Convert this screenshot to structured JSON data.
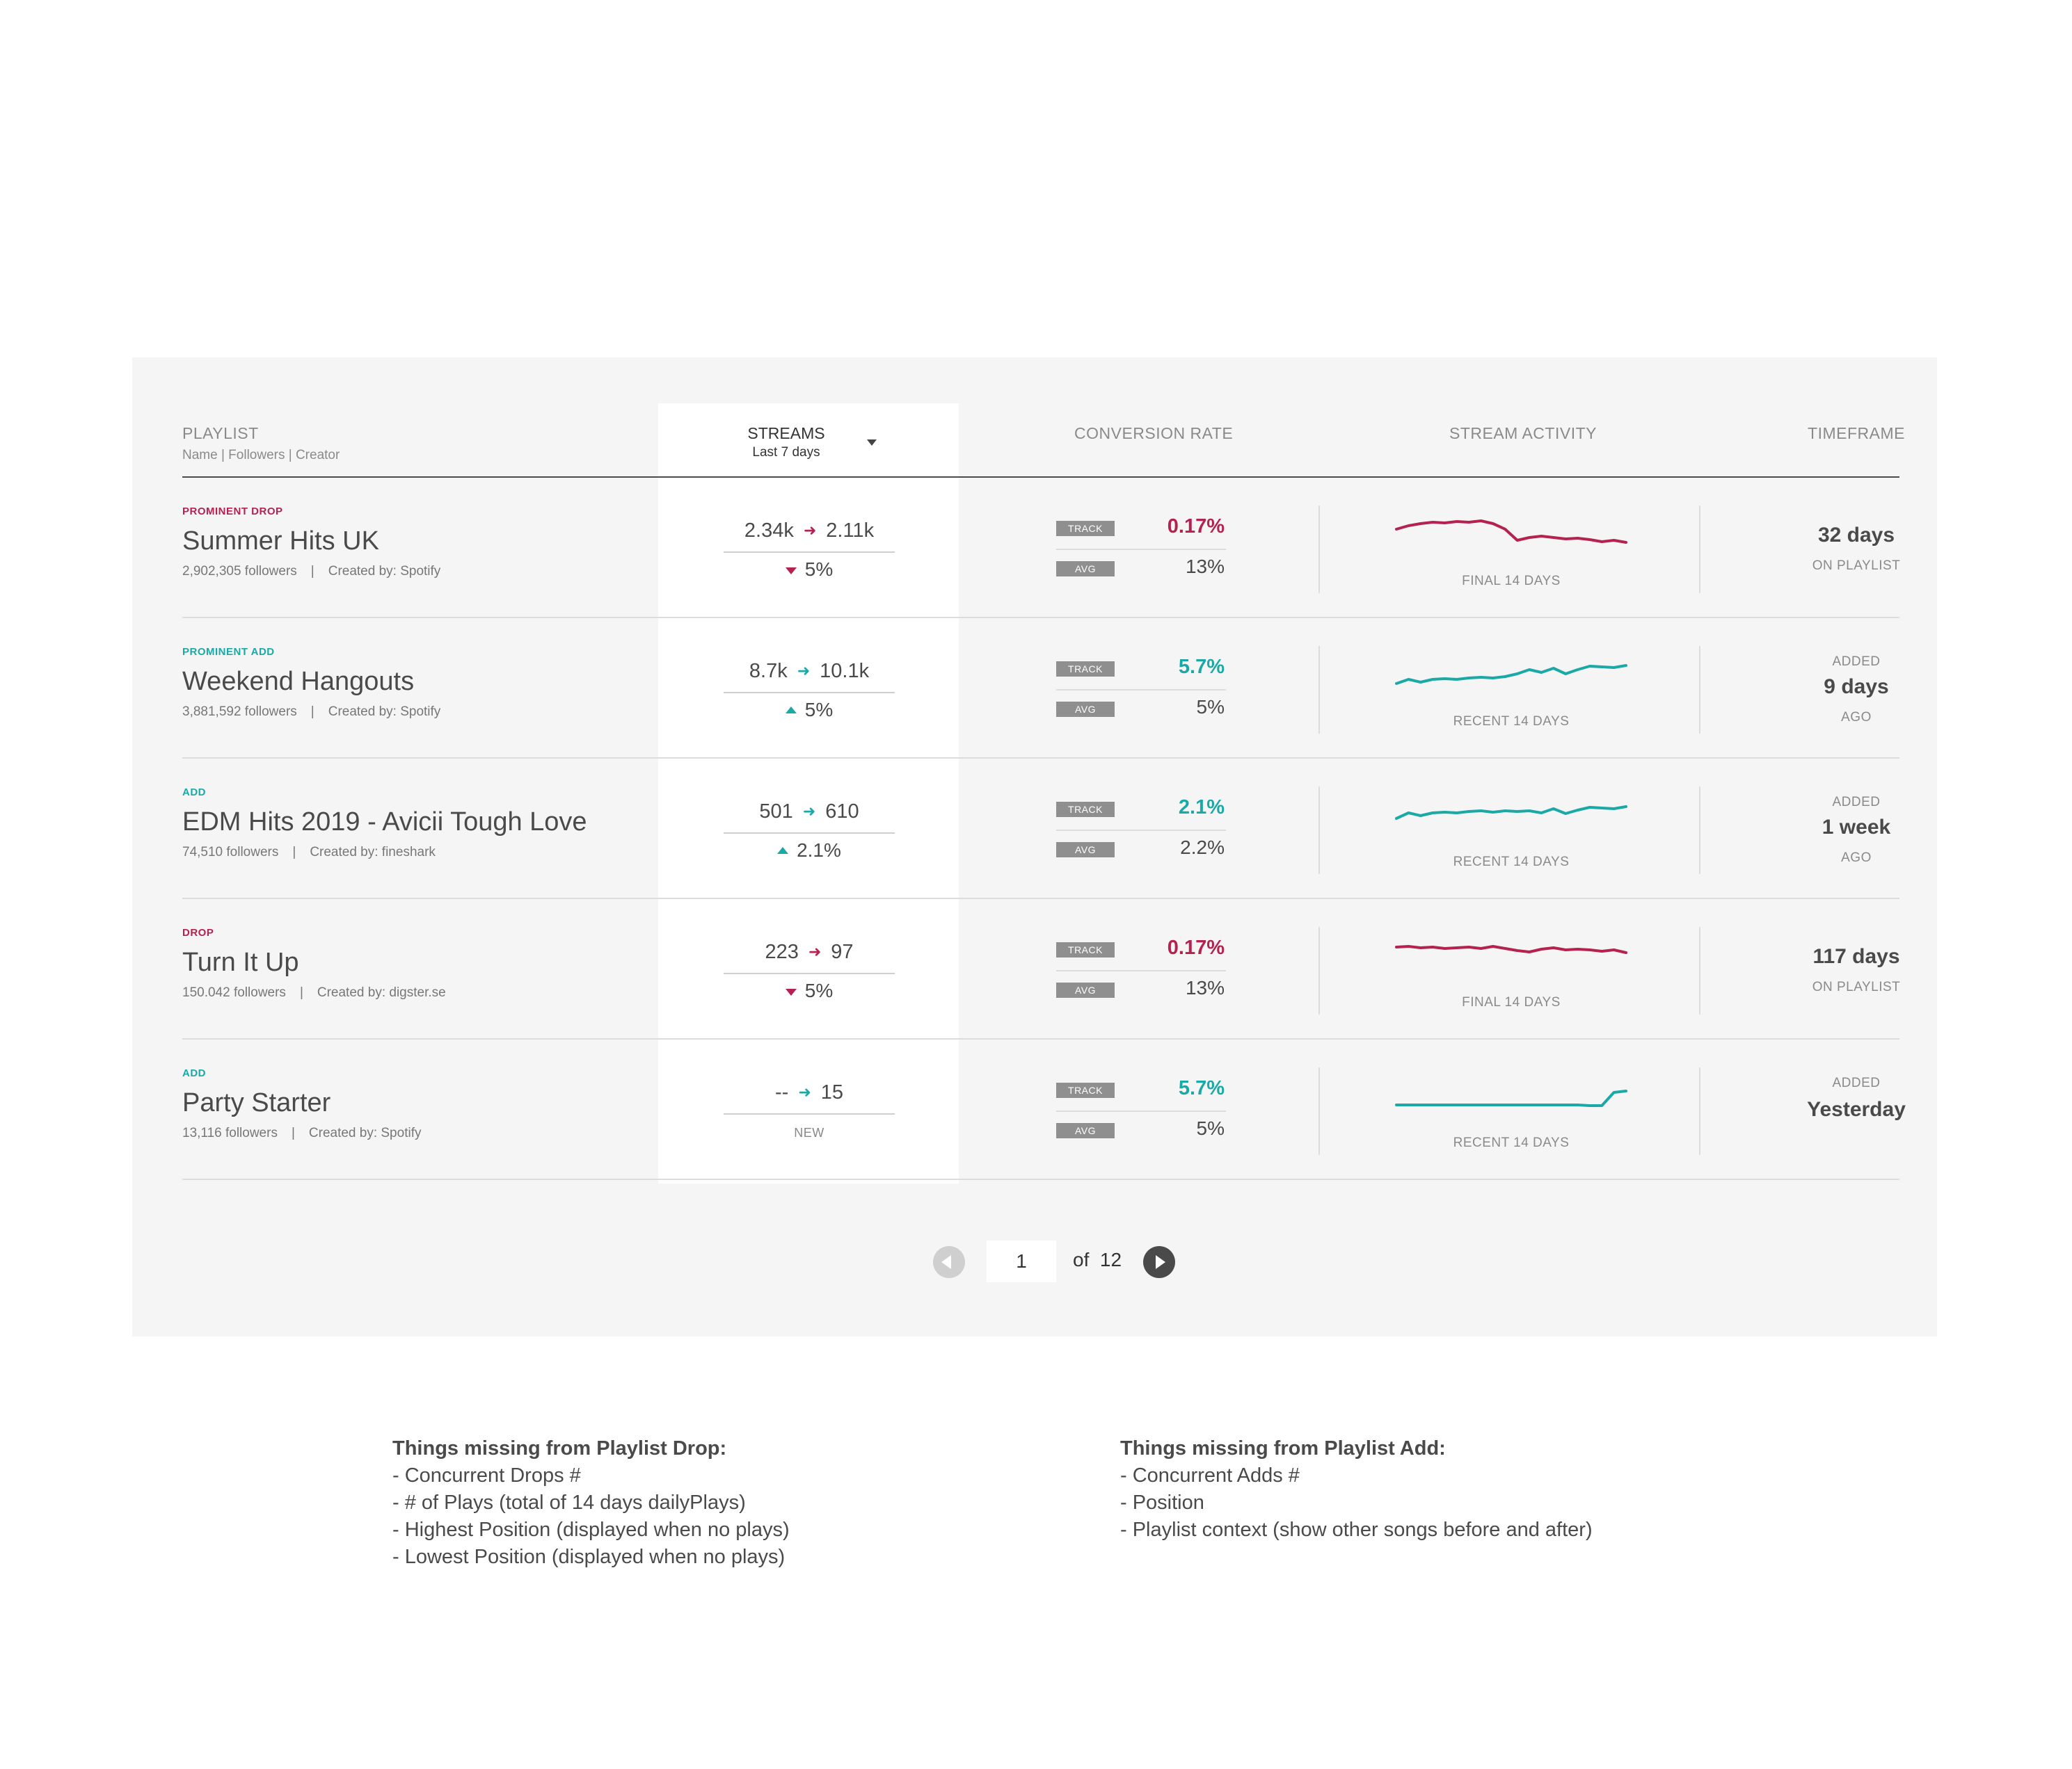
{
  "header": {
    "playlist": "PLAYLIST",
    "playlist_sub": "Name | Followers | Creator",
    "streams": "STREAMS",
    "streams_sub": "Last 7 days",
    "conversion_rate": "CONVERSION RATE",
    "stream_activity": "STREAM ACTIVITY",
    "timeframe": "TIMEFRAME"
  },
  "tags": {
    "track": "TRACK",
    "avg": "AVG"
  },
  "colors": {
    "drop": "#b5224f",
    "add": "#1aa9a7"
  },
  "rows": [
    {
      "status": "PROMINENT DROP",
      "type": "drop",
      "name": "Summer Hits UK",
      "followers": "2,902,305 followers",
      "creator": "Created by: Spotify",
      "streams_from": "2.34k",
      "streams_to": "2.11k",
      "change": "5%",
      "change_dir": "down",
      "conv_track": "0.17%",
      "conv_avg": "13%",
      "activity_caption": "FINAL 14 DAYS",
      "activity": [
        30,
        35,
        38,
        40,
        39,
        41,
        40,
        42,
        38,
        30,
        14,
        18,
        20,
        18,
        16,
        17,
        15,
        12,
        14,
        11
      ],
      "tf_top": "",
      "tf_main": "32 days",
      "tf_bottom": "ON PLAYLIST"
    },
    {
      "status": "PROMINENT ADD",
      "type": "add",
      "name": "Weekend Hangouts",
      "followers": "3,881,592 followers",
      "creator": "Created by: Spotify",
      "streams_from": "8.7k",
      "streams_to": "10.1k",
      "change": "5%",
      "change_dir": "up",
      "conv_track": "5.7%",
      "conv_avg": "5%",
      "activity_caption": "RECENT 14 DAYS",
      "activity": [
        10,
        16,
        12,
        16,
        17,
        16,
        18,
        19,
        18,
        20,
        24,
        30,
        26,
        32,
        24,
        30,
        35,
        34,
        33,
        36
      ],
      "tf_top": "ADDED",
      "tf_main": "9 days",
      "tf_bottom": "AGO"
    },
    {
      "status": "ADD",
      "type": "add",
      "name": "EDM Hits 2019 - Avicii Tough Love",
      "followers": "74,510 followers",
      "creator": "Created by: fineshark",
      "streams_from": "501",
      "streams_to": "610",
      "change": "2.1%",
      "change_dir": "up",
      "conv_track": "2.1%",
      "conv_avg": "2.2%",
      "activity_caption": "RECENT 14 DAYS",
      "activity": [
        18,
        26,
        22,
        26,
        27,
        26,
        28,
        29,
        27,
        29,
        28,
        29,
        26,
        32,
        25,
        30,
        34,
        33,
        32,
        35
      ],
      "tf_top": "ADDED",
      "tf_main": "1 week",
      "tf_bottom": "AGO"
    },
    {
      "status": "DROP",
      "type": "drop",
      "name": "Turn It Up",
      "followers": "150.042 followers",
      "creator": "Created by: digster.se",
      "streams_from": "223",
      "streams_to": "97",
      "change": "5%",
      "change_dir": "down",
      "conv_track": "0.17%",
      "conv_avg": "13%",
      "activity_caption": "FINAL 14 DAYS",
      "activity": [
        35,
        36,
        34,
        35,
        33,
        34,
        35,
        33,
        36,
        33,
        30,
        28,
        32,
        34,
        31,
        32,
        31,
        29,
        31,
        27
      ],
      "tf_top": "",
      "tf_main": "117 days",
      "tf_bottom": "ON PLAYLIST"
    },
    {
      "status": "ADD",
      "type": "add",
      "name": "Party Starter",
      "followers": "13,116 followers",
      "creator": "Created by: Spotify",
      "streams_from": "--",
      "streams_to": "15",
      "change": "NEW",
      "change_dir": "new",
      "conv_track": "5.7%",
      "conv_avg": "5%",
      "activity_caption": "RECENT 14 DAYS",
      "activity": [
        10,
        10,
        10,
        10,
        10,
        10,
        10,
        10,
        10,
        10,
        10,
        10,
        10,
        10,
        10,
        10,
        9,
        9,
        28,
        30
      ],
      "tf_top": "ADDED",
      "tf_main": "Yesterday",
      "tf_bottom": ""
    }
  ],
  "pager": {
    "current": "1",
    "of_text": "of",
    "total": "12"
  },
  "notes": {
    "drop_title": "Things missing from Playlist Drop:",
    "drop_items": [
      "- Concurrent Drops #",
      "- # of Plays (total of 14 days dailyPlays)",
      "- Highest Position (displayed when no plays)",
      "- Lowest Position (displayed when no plays)"
    ],
    "add_title": "Things missing from Playlist Add:",
    "add_items": [
      "- Concurrent Adds #",
      "- Position",
      "- Playlist context (show other songs before and after)"
    ]
  }
}
